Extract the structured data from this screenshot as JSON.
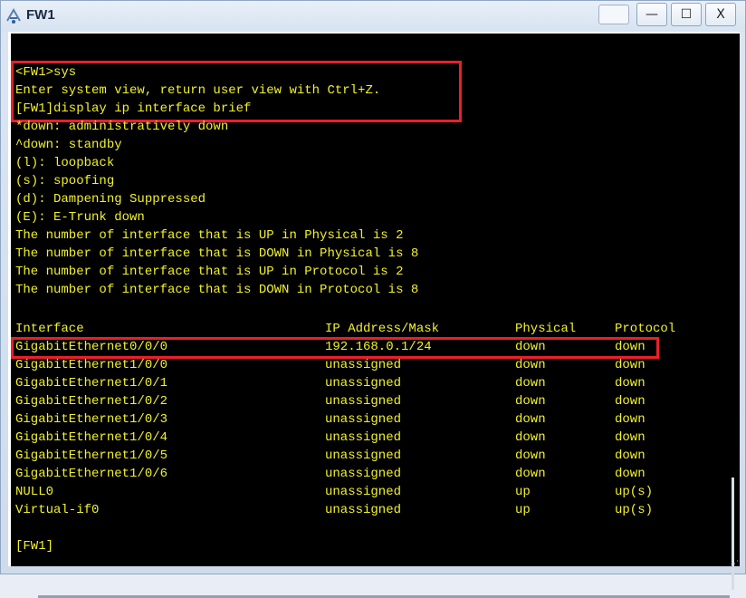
{
  "window": {
    "title": "FW1",
    "icon": "terminal-app-icon",
    "buttons": {
      "minimize": "—",
      "maximize": "☐",
      "close": "X"
    }
  },
  "terminal": {
    "colors": {
      "text": "#f2f22a",
      "background": "#000000",
      "highlight": "#e8202a"
    },
    "lines": [
      "<FW1>sys",
      "Enter system view, return user view with Ctrl+Z.",
      "[FW1]display ip interface brief",
      "*down: administratively down",
      "^down: standby",
      "(l): loopback",
      "(s): spoofing",
      "(d): Dampening Suppressed",
      "(E): E-Trunk down",
      "The number of interface that is UP in Physical is 2",
      "The number of interface that is DOWN in Physical is 8",
      "The number of interface that is UP in Protocol is 2",
      "The number of interface that is DOWN in Protocol is 8"
    ],
    "table": {
      "headers": [
        "Interface",
        "IP Address/Mask",
        "Physical",
        "Protocol"
      ],
      "rows": [
        [
          "GigabitEthernet0/0/0",
          "192.168.0.1/24",
          "down",
          "down"
        ],
        [
          "GigabitEthernet1/0/0",
          "unassigned",
          "down",
          "down"
        ],
        [
          "GigabitEthernet1/0/1",
          "unassigned",
          "down",
          "down"
        ],
        [
          "GigabitEthernet1/0/2",
          "unassigned",
          "down",
          "down"
        ],
        [
          "GigabitEthernet1/0/3",
          "unassigned",
          "down",
          "down"
        ],
        [
          "GigabitEthernet1/0/4",
          "unassigned",
          "down",
          "down"
        ],
        [
          "GigabitEthernet1/0/5",
          "unassigned",
          "down",
          "down"
        ],
        [
          "GigabitEthernet1/0/6",
          "unassigned",
          "down",
          "down"
        ],
        [
          "NULL0",
          "unassigned",
          "up",
          "up(s)"
        ],
        [
          "Virtual-if0",
          "unassigned",
          "up",
          "up(s)"
        ]
      ]
    },
    "prompt": "[FW1]"
  }
}
